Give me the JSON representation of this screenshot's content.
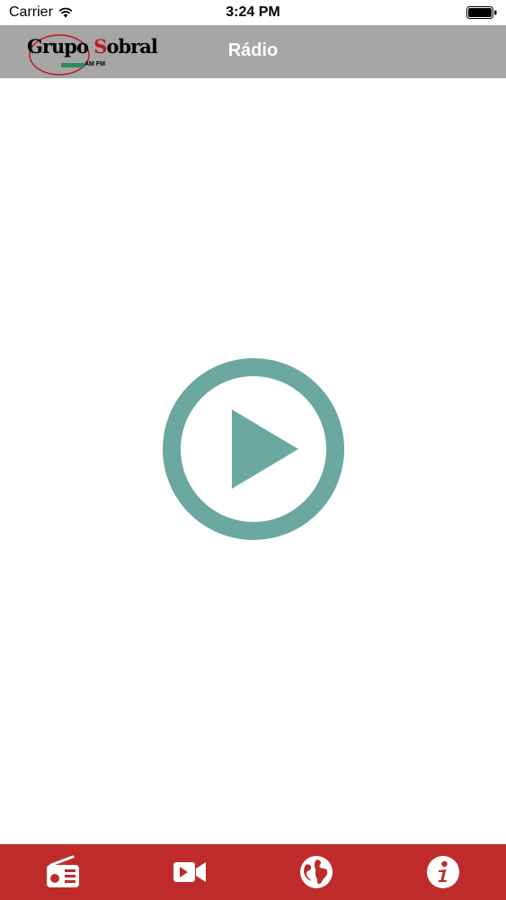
{
  "status_bar": {
    "carrier": "Carrier",
    "time": "3:24 PM"
  },
  "nav_bar": {
    "title": "Rádio",
    "logo": {
      "text_part1": "Grupo ",
      "text_accent": "S",
      "text_part2": "obral",
      "subtext": "AM FM"
    }
  },
  "player": {
    "play_icon": "play-circle-icon",
    "color": "#6aa8a0"
  },
  "tab_bar": {
    "background": "#bf2b2b",
    "tabs": [
      {
        "id": "radio",
        "icon": "radio-icon"
      },
      {
        "id": "video",
        "icon": "video-camera-icon"
      },
      {
        "id": "web",
        "icon": "globe-icon"
      },
      {
        "id": "info",
        "icon": "info-icon"
      }
    ]
  }
}
